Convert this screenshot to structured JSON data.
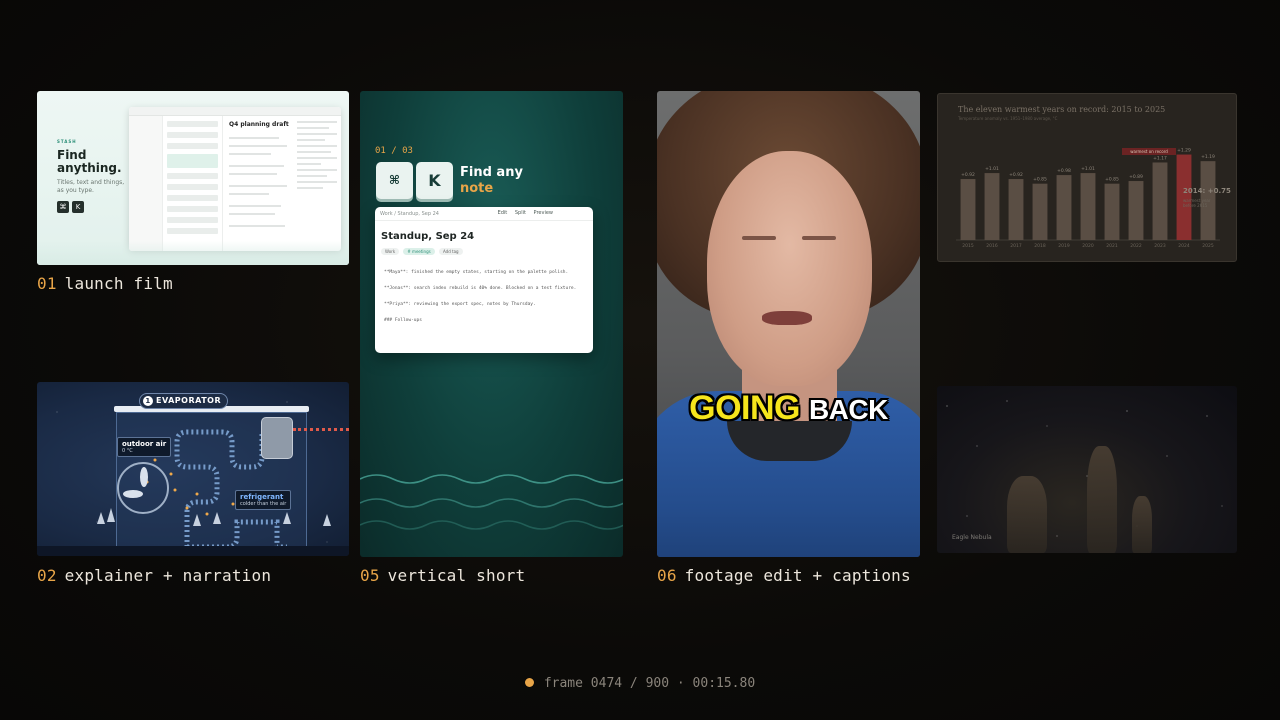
{
  "tiles": {
    "launch": {
      "number": "01",
      "label": "launch film",
      "app_brand": "STASH",
      "headline": "Find anything.",
      "subline": "Titles, text and things, as you type.",
      "keys": [
        "⌘",
        "K"
      ],
      "doc_title": "Q4 planning draft"
    },
    "explainer": {
      "number": "02",
      "label": "explainer + narration",
      "step": "1",
      "heading": "EVAPORATOR",
      "outdoor_title": "outdoor air",
      "outdoor_value": "0 °C",
      "refrigerant_title": "refrigerant",
      "refrigerant_note": "colder than the air"
    },
    "short": {
      "number": "05",
      "label": "vertical short",
      "counter": "01 / 03",
      "keys": [
        "⌘",
        "K"
      ],
      "find_line1": "Find any",
      "find_line2": "note",
      "card": {
        "breadcrumb": "Work / Standup, Sep 24",
        "tabs": [
          "Edit",
          "Split",
          "Preview"
        ],
        "title": "Standup, Sep 24",
        "chips": [
          "Work",
          "# meetings",
          "Add tag"
        ],
        "lines": [
          "**Maya**: finished the empty states, starting on the palette polish.",
          "**Jonas**: search index rebuild is 40% done. Blocked on a test fixture.",
          "**Priya**: reviewing the export spec, notes by Thursday.",
          "### Follow-ups"
        ]
      }
    },
    "footage": {
      "number": "06",
      "label": "footage edit + captions",
      "caption_word1": "GOING",
      "caption_word2": "BACK"
    },
    "chart": {
      "title": "The eleven warmest years on record: 2015 to 2025",
      "subtitle": "Temperature anomaly vs. 1951–1980 average, °C",
      "record_label": "warmest on record",
      "callout_value": "2014: +0.75",
      "callout_note": "warmest year before 2015"
    },
    "nebula": {
      "credit": "Eagle Nebula"
    }
  },
  "chart_data": {
    "type": "bar",
    "title": "The eleven warmest years on record: 2015 to 2025",
    "categories": [
      "2015",
      "2016",
      "2017",
      "2018",
      "2019",
      "2020",
      "2021",
      "2022",
      "2023",
      "2024",
      "2025"
    ],
    "values": [
      0.92,
      1.01,
      0.92,
      0.85,
      0.98,
      1.01,
      0.85,
      0.89,
      1.17,
      1.29,
      1.19
    ],
    "value_labels": [
      "+0.92",
      "+1.01",
      "+0.92",
      "+0.85",
      "+0.98",
      "+1.01",
      "+0.85",
      "+0.89",
      "+1.17",
      "+1.29",
      "+1.19"
    ],
    "highlight_index": 9,
    "ylim": [
      0,
      1.6
    ],
    "colors": {
      "bar": "#5a4e44",
      "highlight": "#8a2f2f",
      "label": "#8d857a"
    }
  },
  "status": {
    "frame": "frame 0474 / 900 · 00:15.80"
  },
  "colors": {
    "accent": "#e8a548",
    "background": "#0b0a08",
    "caption_text": "#ece6dc"
  }
}
